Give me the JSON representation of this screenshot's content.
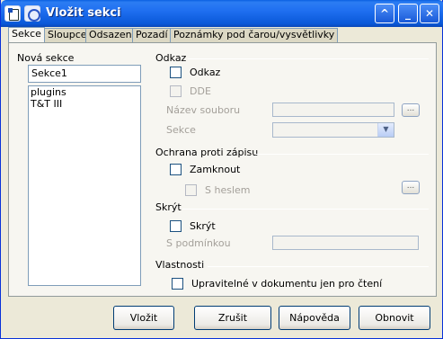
{
  "window": {
    "title": "Vložit sekci"
  },
  "tabs": [
    "Sekce",
    "Sloupce",
    "Odsazení",
    "Pozadí",
    "Poznámky pod čarou/vysvětlivky"
  ],
  "new_section": {
    "heading": "Nová sekce",
    "name_value": "Sekce1",
    "list_items": [
      "plugins",
      "T&T III"
    ]
  },
  "link": {
    "heading": "Odkaz",
    "odkaz_label": "Odkaz",
    "dde_label": "DDE",
    "file_name_label": "Název souboru",
    "file_browse_label": "...",
    "section_label": "Sekce"
  },
  "write_protection": {
    "heading": "Ochrana proti zápisu",
    "lock_label": "Zamknout",
    "password_label": "S heslem",
    "password_button_label": "..."
  },
  "hide": {
    "heading": "Skrýt",
    "hide_label": "Skrýt",
    "condition_label": "S podmínkou"
  },
  "properties": {
    "heading": "Vlastnosti",
    "editable_label": "Upravitelné v dokumentu jen pro čtení"
  },
  "buttons": {
    "insert": "Vložit",
    "cancel": "Zrušit",
    "help": "Nápověda",
    "reset": "Obnovit"
  }
}
